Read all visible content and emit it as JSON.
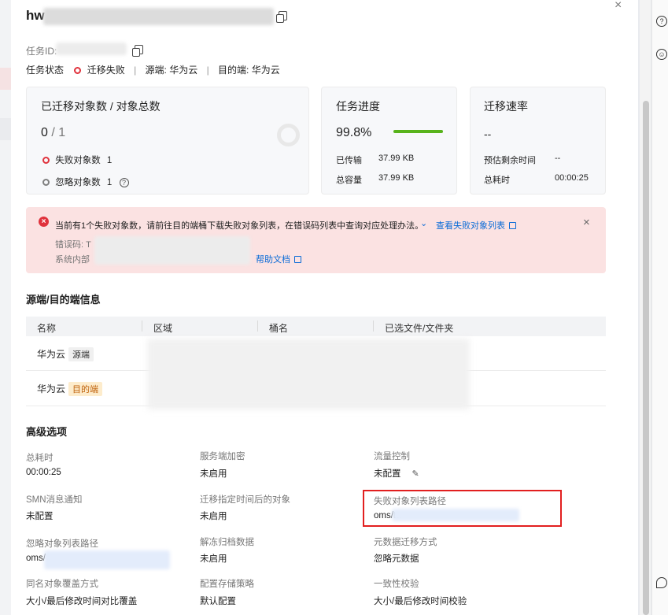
{
  "title_prefix": "hw",
  "task_id_label": "任务ID:",
  "status_line": {
    "status_label": "任务状态",
    "status_value": "迁移失败",
    "sep": "|",
    "source_label": "源端:",
    "source_value": "华为云",
    "dest_label": "目的端:",
    "dest_value": "华为云"
  },
  "card_objects": {
    "title": "已迁移对象数 / 对象总数",
    "migrated": "0",
    "slash": " / ",
    "total": "1",
    "failed_label": "失败对象数",
    "failed_value": "1",
    "ignored_label": "忽略对象数",
    "ignored_value": "1",
    "help_icon": "question-circle-icon"
  },
  "card_progress": {
    "title": "任务进度",
    "percent": "99.8%",
    "percent_value": 0.998,
    "transferred_label": "已传输",
    "transferred_value": "37.99 KB",
    "total_label": "总容量",
    "total_value": "37.99 KB"
  },
  "card_speed": {
    "title": "迁移速率",
    "speed": "--",
    "remaining_label": "预估剩余时间",
    "remaining_value": "--",
    "elapsed_label": "总耗时",
    "elapsed_value": "00:00:25"
  },
  "alert": {
    "message": "当前有1个失败对象数，请前往目的端桶下载失败对象列表，在错误码列表中查询对应处理办法。",
    "expand_icon": "chevron-down-icon",
    "view_failed_link": "查看失败对象列表",
    "error_code_label": "错误码: T",
    "internal_label": "系统内部",
    "help_doc_link": "帮助文档"
  },
  "src_dst": {
    "section_title": "源端/目的端信息",
    "headers": [
      "名称",
      "区域",
      "桶名",
      "已选文件/文件夹"
    ],
    "rows": [
      {
        "name": "华为云",
        "tag": "源端"
      },
      {
        "name": "华为云",
        "tag": "目的端"
      }
    ]
  },
  "advanced": {
    "section_title": "高级选项",
    "items": [
      {
        "label": "总耗时",
        "value": "00:00:25"
      },
      {
        "label": "服务端加密",
        "value": "未启用"
      },
      {
        "label": "流量控制",
        "value": "未配置"
      },
      {
        "label": "SMN消息通知",
        "value": "未配置"
      },
      {
        "label": "迁移指定时间后的对象",
        "value": "未启用"
      },
      {
        "label": "失败对象列表路径",
        "value": "oms/ta"
      },
      {
        "label": "忽略对象列表路径",
        "value": "oms/"
      },
      {
        "label": "解冻归档数据",
        "value": "未启用"
      },
      {
        "label": "元数据迁移方式",
        "value": "忽略元数据"
      },
      {
        "label": "同名对象覆盖方式",
        "value": "大小/最后修改时间对比覆盖"
      },
      {
        "label": "配置存储策略",
        "value": "默认配置"
      },
      {
        "label": "一致性校验",
        "value": "大小/最后修改时间校验"
      }
    ]
  },
  "colors": {
    "accent_link": "#0a6bd7",
    "error_red": "#e0323c",
    "alert_bg": "#fbe2e2",
    "progress_green": "#58b31b",
    "highlight_red": "#e21f1f"
  }
}
